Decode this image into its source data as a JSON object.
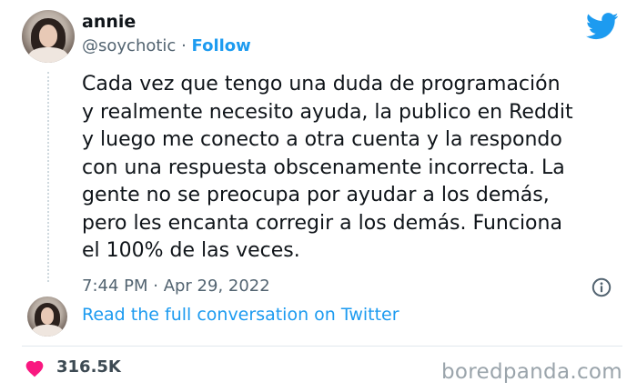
{
  "tweet": {
    "author_name": "annie",
    "handle": "@soychotic",
    "separator": "·",
    "follow_label": "Follow",
    "text": "Cada vez que tengo una duda de programación\ny realmente necesito ayuda, la publico en Reddit\ny luego me conecto a otra cuenta y la respondo\ncon una respuesta obscenamente incorrecta. La\ngente no se preocupa por ayudar a los demás,\npero les encanta corregir a los demás. Funciona\nel 100% de las veces.",
    "timestamp": "7:44 PM · Apr 29, 2022",
    "read_link": "Read the full conversation on Twitter",
    "likes": "316.5K"
  },
  "icons": {
    "brand": "twitter-bird-icon",
    "info": "info-icon",
    "like": "heart-icon"
  },
  "colors": {
    "link_blue": "#1d9bf0",
    "heart_pink": "#f91880",
    "muted_text": "#536471"
  },
  "watermark": "boredpanda.com"
}
